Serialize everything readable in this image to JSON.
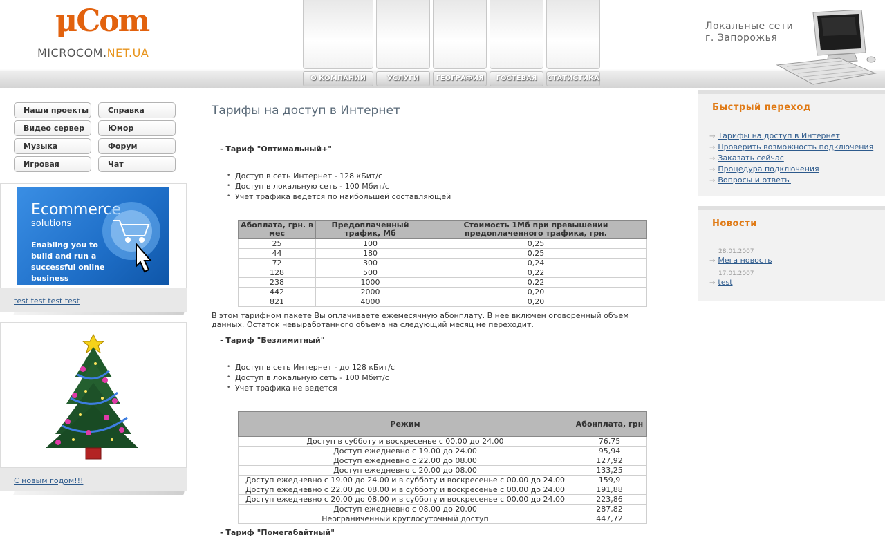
{
  "header": {
    "logo_mark": "μCom",
    "logo_sub_main": "MICROCOM.",
    "logo_sub_accent": "NET.UA",
    "nav": [
      "О КОМПАНИИ",
      "УСЛУГИ",
      "ГЕОГРАФИЯ",
      "ГОСТЕВАЯ",
      "СТАТИСТИКА"
    ],
    "tagline_1": "Локальные сети",
    "tagline_2": "г. Запорожья"
  },
  "sidebar": {
    "buttons": [
      "Наши проекты",
      "Справка",
      "Видео сервер",
      "Юмор",
      "Музыка",
      "Форум",
      "Игровая",
      "Чат"
    ],
    "banner": {
      "title": "Ecommerce",
      "subtitle": "solutions",
      "text": "Enabling you to build and run a successful online business",
      "link": "test test test test"
    },
    "xmas": {
      "link": "С новым годом!!!"
    }
  },
  "main": {
    "title": "Тарифы на доступ в Интернет",
    "tariff1": {
      "heading": "- Тариф \"Оптимальный+\"",
      "bullets": [
        "Доступ в сеть Интернет  -  128 кБит/с",
        "Доступ в локальную сеть - 100 Мбит/с",
        "Учет трафика ведется по наибольшей составляющей"
      ],
      "table_headers": [
        "Абоплата, грн. в мес",
        "Предоплаченный трафик, Мб",
        "Стоимость 1Мб при превышении предоплаченного трафика, грн."
      ],
      "rows": [
        [
          "25",
          "100",
          "0,25"
        ],
        [
          "44",
          "180",
          "0,25"
        ],
        [
          "72",
          "300",
          "0,24"
        ],
        [
          "128",
          "500",
          "0,22"
        ],
        [
          "238",
          "1000",
          "0,22"
        ],
        [
          "442",
          "2000",
          "0,20"
        ],
        [
          "821",
          "4000",
          "0,20"
        ]
      ],
      "note": "В этом тарифном пакете Вы оплачиваете ежемесячную абонплату. В нее включен оговоренный объем данных. Остаток невыработанного объема на следующий месяц не переходит."
    },
    "tariff2": {
      "heading": "- Тариф \"Безлимитный\"",
      "bullets": [
        "Доступ в сеть Интернет  -  до 128 кБит/с",
        "Доступ в локальную сеть - 100 Мбит/с",
        "Учет трафика не ведется"
      ],
      "table_headers": [
        "Режим",
        "Абонплата, грн"
      ],
      "rows": [
        [
          "Доступ в субботу и воскресенье с 00.00 до 24.00",
          "76,75"
        ],
        [
          "Доступ ежедневно с 19.00 до 24.00",
          "95,94"
        ],
        [
          "Доступ ежедневно с 22.00 до 08.00",
          "127,92"
        ],
        [
          "Доступ ежедневно с 20.00 до 08.00",
          "133,25"
        ],
        [
          "Доступ ежедневно с 19.00 до 24.00 и в субботу и воскресенье с 00.00 до 24.00",
          "159,9"
        ],
        [
          "Доступ ежедневно с 22.00 до 08.00 и в субботу и воскресенье с 00.00 до 24.00",
          "191,88"
        ],
        [
          "Доступ ежедневно с 20.00 до 08.00 и в субботу и воскресенье с 00.00 до 24.00",
          "223,86"
        ],
        [
          "Доступ ежедневно с 08.00 до 20.00",
          "287,82"
        ],
        [
          "Неограниченный круглосуточный доступ",
          "447,72"
        ]
      ]
    },
    "tariff3": {
      "heading": "- Тариф \"Помегабайтный\""
    }
  },
  "right": {
    "quick": {
      "title": "Быстрый переход",
      "links": [
        "Тарифы на доступ в Интернет",
        "Проверить возможность подключения",
        "Заказать сейчас",
        "Процедура подключения",
        "Вопросы и ответы"
      ]
    },
    "news": {
      "title": "Новости",
      "items": [
        {
          "date": "28.01.2007",
          "title": "Мега новость"
        },
        {
          "date": "17.01.2007",
          "title": "test"
        }
      ]
    }
  },
  "colors": {
    "accent": "#e2620e",
    "link": "#2d5a8c",
    "table_header": "#b9b9b9"
  }
}
